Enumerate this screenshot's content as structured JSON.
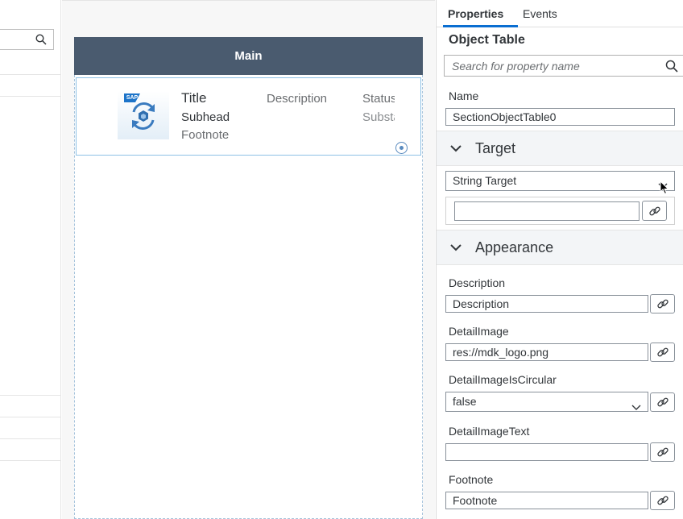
{
  "canvas": {
    "header_title": "Main",
    "item": {
      "title": "Title",
      "subhead": "Subhead",
      "footnote": "Footnote",
      "description": "Description",
      "status": "Status",
      "substatus": "Substatus",
      "image_badge": "SAP"
    }
  },
  "panel": {
    "tabs": [
      {
        "label": "Properties",
        "active": true
      },
      {
        "label": "Events",
        "active": false
      }
    ],
    "title": "Object Table",
    "search_placeholder": "Search for property name",
    "name_label": "Name",
    "name_value": "SectionObjectTable0",
    "groups": {
      "target": "Target",
      "appearance": "Appearance"
    },
    "target_value": "String Target",
    "target_text": "",
    "props": [
      {
        "label": "Description",
        "value": "Description"
      },
      {
        "label": "DetailImage",
        "value": "res://mdk_logo.png"
      },
      {
        "label": "DetailImageIsCircular",
        "value": "false"
      },
      {
        "label": "DetailImageText",
        "value": ""
      },
      {
        "label": "Footnote",
        "value": "Footnote"
      }
    ]
  },
  "colors": {
    "header_bg": "#4a5b6f",
    "accent": "#0a6ed1",
    "selection_border": "#8ec1e6"
  },
  "icons": [
    "search-icon",
    "link-icon",
    "chevron-down-icon",
    "sync-icon",
    "radio-indicator-icon",
    "cursor-icon"
  ]
}
